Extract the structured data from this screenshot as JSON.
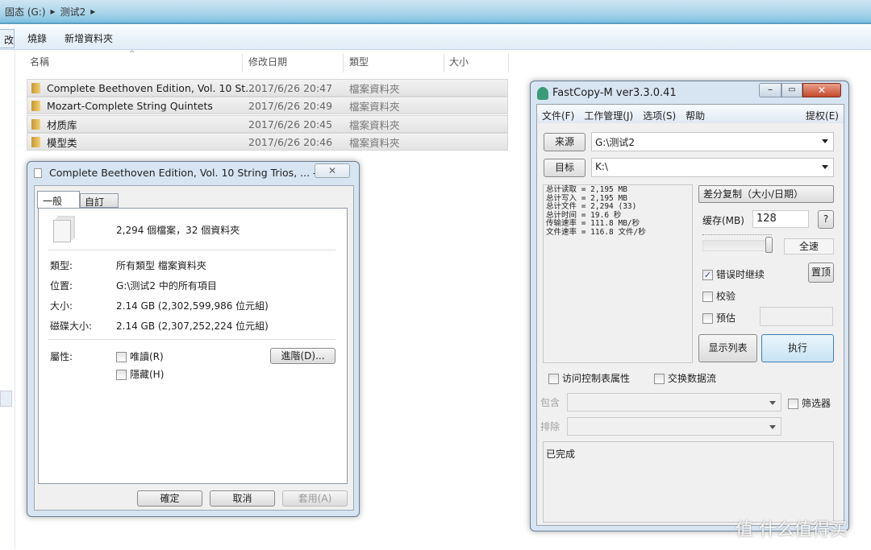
{
  "explorer": {
    "breadcrumb": [
      "固态 (G:)",
      "测试2"
    ],
    "toolbar": {
      "cut_label": "改",
      "burn": "燒錄",
      "new_folder": "新增資料夾"
    },
    "columns": {
      "name": "名稱",
      "date": "修改日期",
      "type": "類型",
      "size": "大小"
    },
    "rows": [
      {
        "name": "Complete Beethoven Edition, Vol. 10 St...",
        "date": "2017/6/26 20:47",
        "type": "檔案資料夾"
      },
      {
        "name": "Mozart-Complete String Quintets",
        "date": "2017/6/26 20:49",
        "type": "檔案資料夾"
      },
      {
        "name": "材质库",
        "date": "2017/6/26 20:45",
        "type": "檔案資料夾"
      },
      {
        "name": "模型类",
        "date": "2017/6/26 20:46",
        "type": "檔案資料夾"
      }
    ]
  },
  "properties": {
    "title": "Complete Beethoven Edition, Vol. 10 String Trios, ... - ...",
    "tabs": [
      "一般",
      "自訂"
    ],
    "summary": "2,294 個檔案，32 個資料夾",
    "fields": [
      {
        "label": "類型:",
        "value": "所有類型 檔案資料夾"
      },
      {
        "label": "位置:",
        "value": "G:\\测试2 中的所有項目"
      },
      {
        "label": "大小:",
        "value": "2.14 GB (2,302,599,986 位元組)"
      },
      {
        "label": "磁碟大小:",
        "value": "2.14 GB (2,307,252,224 位元組)"
      }
    ],
    "attributes_label": "屬性:",
    "readonly": "唯讀(R)",
    "hidden": "隱藏(H)",
    "advanced": "進階(D)...",
    "ok": "確定",
    "cancel": "取消",
    "apply": "套用(A)"
  },
  "fastcopy": {
    "title": "FastCopy-M ver3.3.0.41",
    "menu": [
      "文件(F)",
      "工作管理(J)",
      "选项(S)",
      "帮助"
    ],
    "menu_right": "提权(E)",
    "source_btn": "来源",
    "source": "G:\\测试2",
    "dest_btn": "目标",
    "dest": "K:\\",
    "log": "总计读取 = 2,195 MB\n总计写入 = 2,195 MB\n总计文件 = 2,294 (33)\n总计时间 = 19.6 秒\n传输速率 = 111.8 MB/秒\n文件速率 = 116.8 文件/秒",
    "mode": "差分复制（大小/日期）",
    "buffer_label": "缓存(MB)",
    "buffer": "128",
    "help": "?",
    "speed_label": "全速",
    "speed_level": 1.0,
    "continue_on_error": "错误时继续",
    "continue_checked": true,
    "topmost": "置顶",
    "verify": "校验",
    "estimate": "预估",
    "list_btn": "显示列表",
    "exec_btn": "执行",
    "acl": "访问控制表属性",
    "ads": "交换数据流",
    "include": "包含",
    "exclude": "排除",
    "filter": "筛选器",
    "status": "已完成"
  },
  "watermark": "值 什么值得买"
}
